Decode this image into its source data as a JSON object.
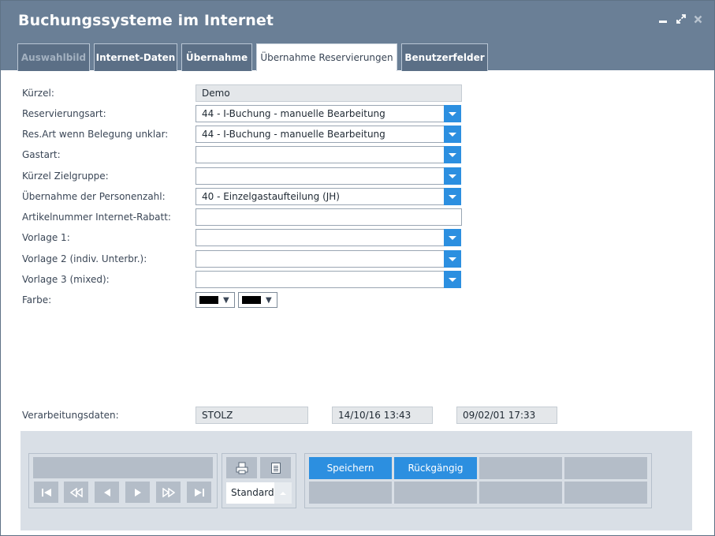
{
  "window": {
    "title": "Buchungssysteme im Internet"
  },
  "tabs": [
    {
      "label": "Auswahlbild",
      "state": "disabled"
    },
    {
      "label": "Internet-Daten",
      "state": "normal"
    },
    {
      "label": "Übernahme",
      "state": "normal"
    },
    {
      "label": "Übernahme Reservierungen",
      "state": "active"
    },
    {
      "label": "Benutzerfelder",
      "state": "normal"
    }
  ],
  "form": {
    "kuerzel": {
      "label": "Kürzel:",
      "value": "Demo"
    },
    "reservierungsart": {
      "label": "Reservierungsart:",
      "value": "44 - I-Buchung - manuelle Bearbeitung"
    },
    "resart_unklar": {
      "label": "Res.Art wenn Belegung unklar:",
      "value": "44 - I-Buchung - manuelle Bearbeitung"
    },
    "gastart": {
      "label": "Gastart:",
      "value": ""
    },
    "zielgruppe": {
      "label": "Kürzel Zielgruppe:",
      "value": ""
    },
    "personenzahl": {
      "label": "Übernahme der Personenzahl:",
      "value": "40 - Einzelgastaufteilung (JH)"
    },
    "artikelnummer": {
      "label": "Artikelnummer Internet-Rabatt:",
      "value": ""
    },
    "vorlage1": {
      "label": "Vorlage 1:",
      "value": ""
    },
    "vorlage2": {
      "label": "Vorlage 2 (indiv. Unterbr.):",
      "value": ""
    },
    "vorlage3": {
      "label": "Vorlage 3 (mixed):",
      "value": ""
    },
    "farbe": {
      "label": "Farbe:",
      "color1": "#000000",
      "color2": "#000000"
    }
  },
  "verarbeitung": {
    "label": "Verarbeitungsdaten:",
    "user": "STOLZ",
    "created": "14/10/16 13:43",
    "modified": "09/02/01 17:33"
  },
  "toolbar": {
    "print_icon": "printer-icon",
    "export_icon": "document-icon",
    "list_select": "Standardli",
    "save_label": "Speichern",
    "undo_label": "Rückgängig"
  },
  "colors": {
    "accent": "#2c8fe0",
    "titlebar": "#6a7f96",
    "tab": "#5b6f86"
  }
}
